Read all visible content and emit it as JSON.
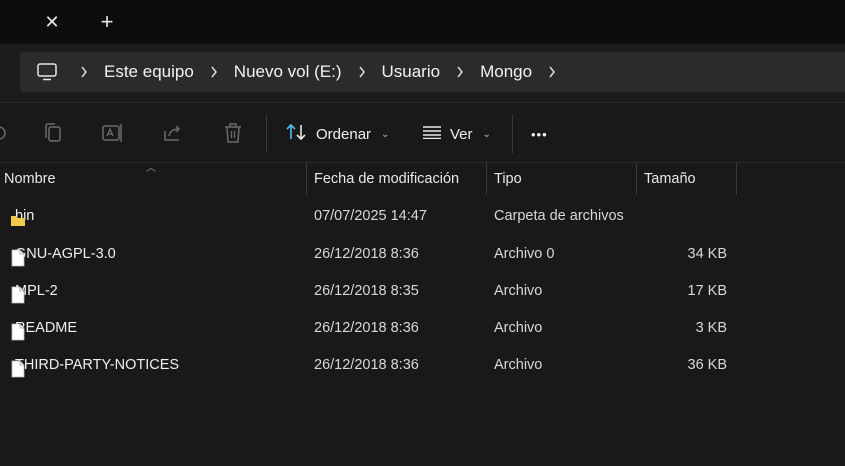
{
  "tabbar": {
    "close_glyph": "✕",
    "new_tab_glyph": "+"
  },
  "breadcrumb": {
    "root_icon": "computer-icon",
    "items": [
      "Este equipo",
      "Nuevo vol (E:)",
      "Usuario",
      "Mongo"
    ]
  },
  "toolbar": {
    "icons": [
      "copy-icon",
      "rename-icon",
      "share-icon",
      "delete-icon"
    ],
    "sort_label": "Ordenar",
    "view_label": "Ver",
    "more_label": "•••"
  },
  "columns": {
    "name": "Nombre",
    "date": "Fecha de modificación",
    "type": "Tipo",
    "size": "Tamaño"
  },
  "files": [
    {
      "name": "bin",
      "date": "07/07/2025 14:47",
      "type": "Carpeta de archivos",
      "size": "",
      "icon": "folder-icon"
    },
    {
      "name": "GNU-AGPL-3.0",
      "date": "26/12/2018 8:36",
      "type": "Archivo 0",
      "size": "34 KB",
      "icon": "file-icon"
    },
    {
      "name": "MPL-2",
      "date": "26/12/2018 8:35",
      "type": "Archivo",
      "size": "17 KB",
      "icon": "file-icon"
    },
    {
      "name": "README",
      "date": "26/12/2018 8:36",
      "type": "Archivo",
      "size": "3 KB",
      "icon": "file-icon"
    },
    {
      "name": "THIRD-PARTY-NOTICES",
      "date": "26/12/2018 8:36",
      "type": "Archivo",
      "size": "36 KB",
      "icon": "file-icon"
    }
  ],
  "colors": {
    "background": "#191919",
    "sort_icon_accent": "#4cc2ff",
    "folder": "#f2c84b"
  }
}
